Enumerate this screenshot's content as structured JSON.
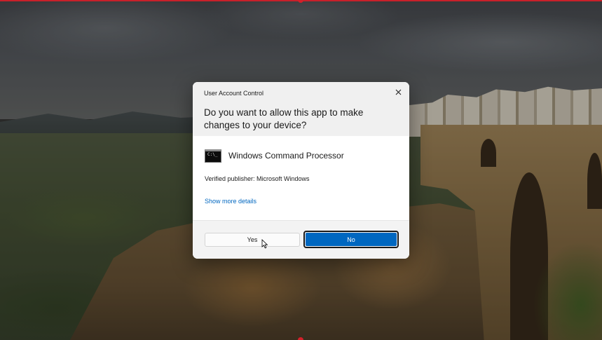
{
  "background": {
    "description_icon": "wallpaper-ronda-bridge",
    "accent_line_color": "#c8202a"
  },
  "dialog": {
    "title": "User Account Control",
    "close_icon": "close-icon",
    "question": "Do you want to allow this app to make changes to your device?",
    "app": {
      "icon": "command-prompt-icon",
      "name": "Windows Command Processor"
    },
    "publisher": "Verified publisher: Microsoft Windows",
    "details_link": "Show more details",
    "buttons": {
      "yes": "Yes",
      "no": "No"
    },
    "colors": {
      "primary": "#0067c0",
      "link": "#0067c0",
      "header_bg": "#f0f0f0"
    }
  }
}
